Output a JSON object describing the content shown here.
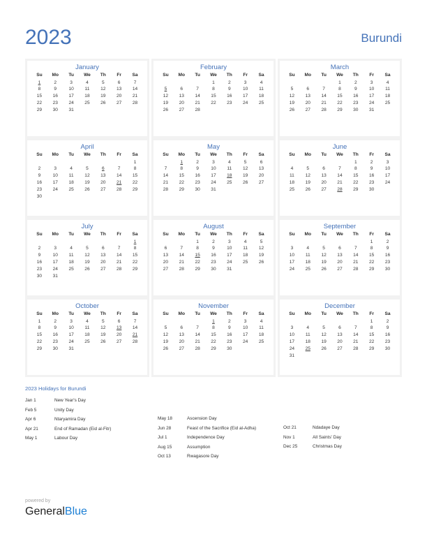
{
  "header": {
    "year": "2023",
    "country": "Burundi",
    "accent_color": "#4472b8",
    "holiday_color": "#e00000"
  },
  "weekday_headers": [
    "Su",
    "Mo",
    "Tu",
    "We",
    "Th",
    "Fr",
    "Sa"
  ],
  "months": [
    {
      "name": "January",
      "lead_blanks": 0,
      "days_in_month": 31,
      "holidays": [
        1
      ]
    },
    {
      "name": "February",
      "lead_blanks": 3,
      "days_in_month": 28,
      "holidays": [
        5
      ]
    },
    {
      "name": "March",
      "lead_blanks": 3,
      "days_in_month": 31,
      "holidays": []
    },
    {
      "name": "April",
      "lead_blanks": 6,
      "days_in_month": 30,
      "holidays": [
        6,
        21
      ]
    },
    {
      "name": "May",
      "lead_blanks": 1,
      "days_in_month": 31,
      "holidays": [
        1,
        18
      ]
    },
    {
      "name": "June",
      "lead_blanks": 4,
      "days_in_month": 30,
      "holidays": [
        28
      ]
    },
    {
      "name": "July",
      "lead_blanks": 6,
      "days_in_month": 31,
      "holidays": [
        1
      ]
    },
    {
      "name": "August",
      "lead_blanks": 2,
      "days_in_month": 31,
      "holidays": [
        15
      ]
    },
    {
      "name": "September",
      "lead_blanks": 5,
      "days_in_month": 30,
      "holidays": []
    },
    {
      "name": "October",
      "lead_blanks": 0,
      "days_in_month": 31,
      "holidays": [
        13,
        21
      ]
    },
    {
      "name": "November",
      "lead_blanks": 3,
      "days_in_month": 30,
      "holidays": [
        1
      ]
    },
    {
      "name": "December",
      "lead_blanks": 5,
      "days_in_month": 31,
      "holidays": [
        25
      ]
    }
  ],
  "holidays_section": {
    "title": "2023 Holidays for Burundi",
    "columns": [
      [
        {
          "date": "Jan 1",
          "name": "New Year's Day"
        },
        {
          "date": "Feb 5",
          "name": "Unity Day"
        },
        {
          "date": "Apr 6",
          "name": "Ntaryamira Day"
        },
        {
          "date": "Apr 21",
          "name": "End of Ramadan (Eid al-Fitr)"
        },
        {
          "date": "May 1",
          "name": "Labour Day"
        }
      ],
      [
        {
          "date": "May 18",
          "name": "Ascension Day"
        },
        {
          "date": "Jun 28",
          "name": "Feast of the Sacrifice (Eid al-Adha)"
        },
        {
          "date": "Jul 1",
          "name": "Independence Day"
        },
        {
          "date": "Aug 15",
          "name": "Assumption"
        },
        {
          "date": "Oct 13",
          "name": "Rwagasore Day"
        }
      ],
      [
        {
          "date": "Oct 21",
          "name": "Ndadaye Day"
        },
        {
          "date": "Nov 1",
          "name": "All Saints' Day"
        },
        {
          "date": "Dec 25",
          "name": "Christmas Day"
        }
      ]
    ]
  },
  "footer": {
    "powered_by": "powered by",
    "brand_part1": "General",
    "brand_part2": "Blue"
  }
}
